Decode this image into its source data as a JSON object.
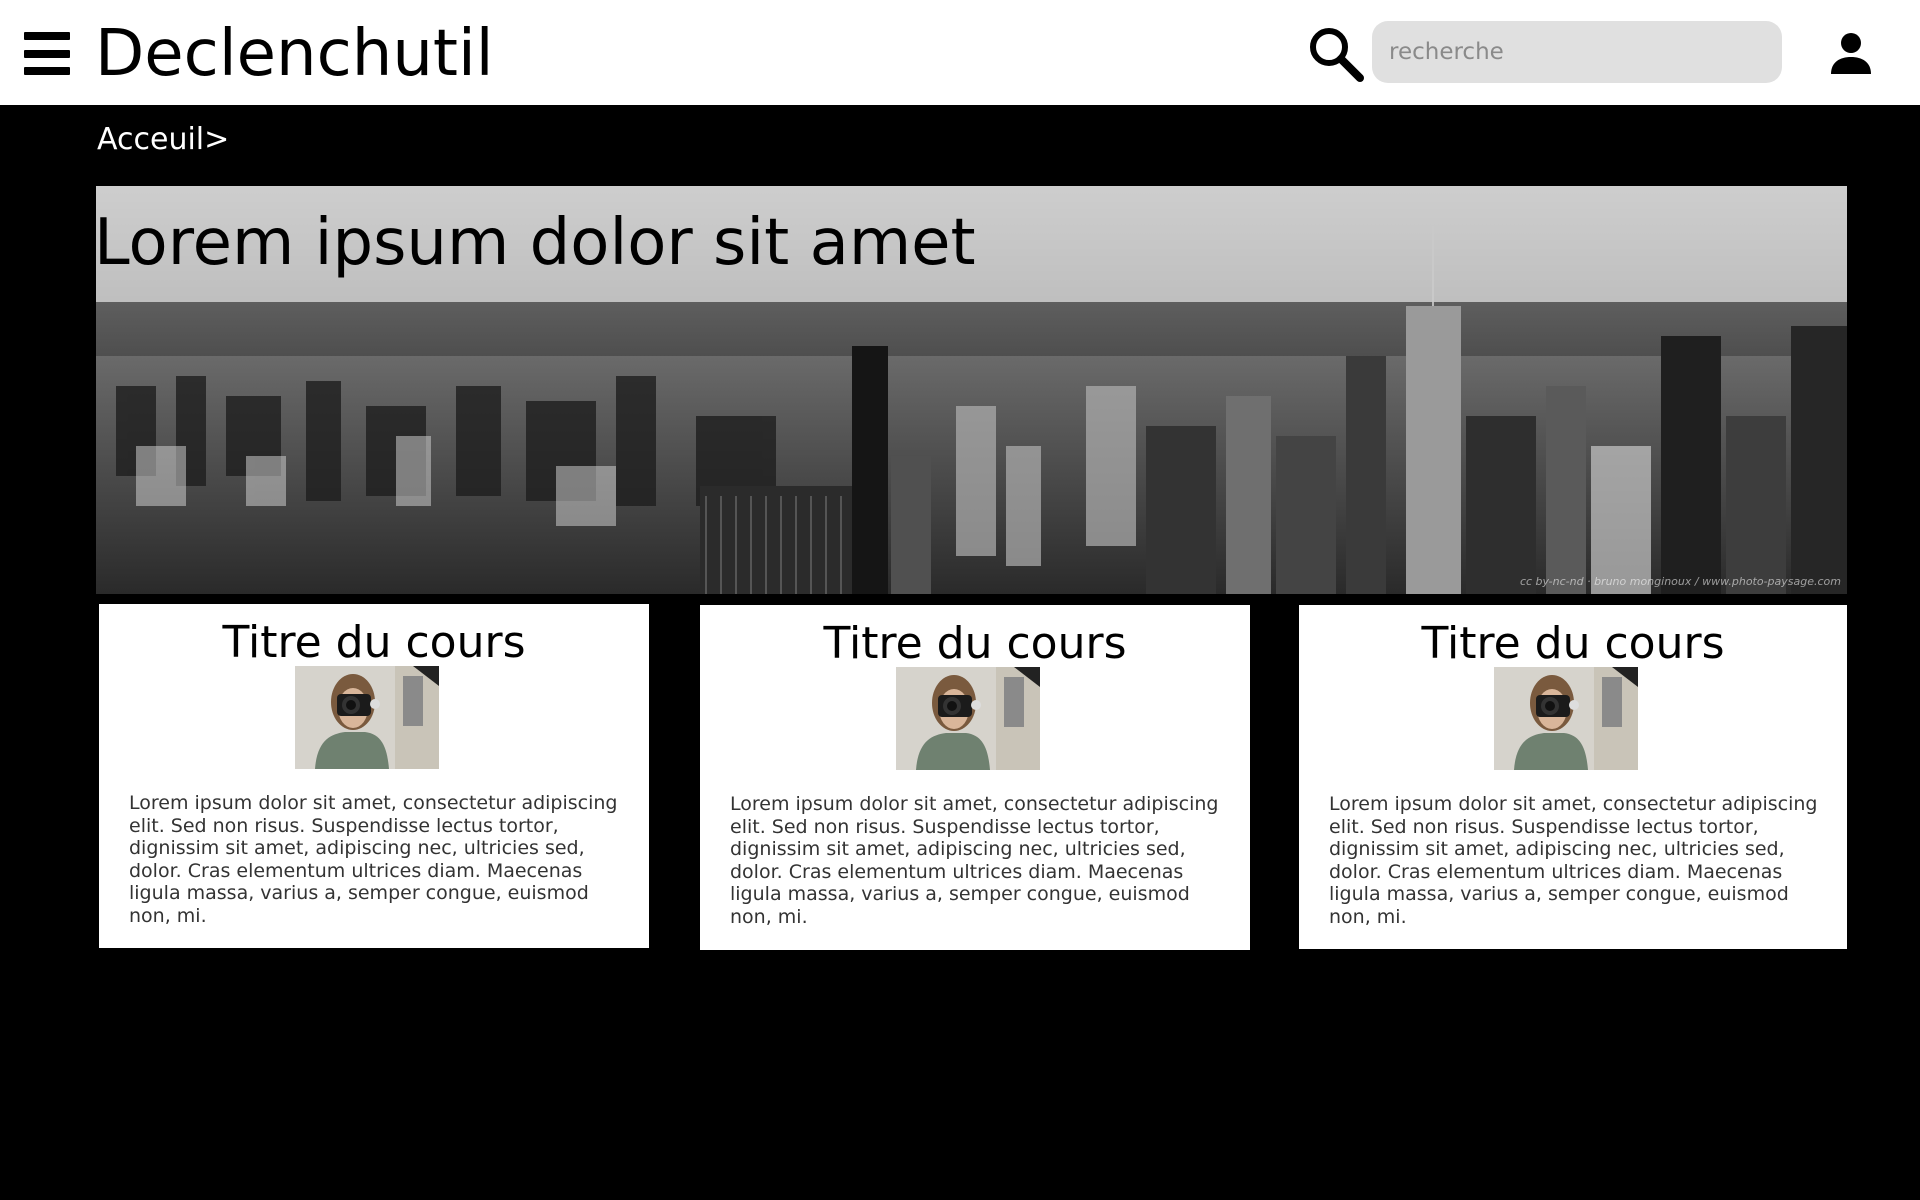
{
  "header": {
    "brand": "Declenchutil",
    "search_placeholder": "recherche",
    "icons": {
      "menu": "hamburger-menu-icon",
      "search": "search-icon",
      "user": "user-icon"
    }
  },
  "breadcrumb": {
    "text": "Acceuil>"
  },
  "hero": {
    "title": "Lorem ipsum dolor sit amet",
    "credit": "cc by-nc-nd · bruno monginoux / www.photo-paysage.com"
  },
  "cards": [
    {
      "title": "Titre du cours",
      "text": "Lorem ipsum dolor sit amet, consectetur adipiscing elit. Sed non risus. Suspendisse lectus tortor, dignissim sit amet, adipiscing nec, ultricies sed, dolor. Cras elementum ultrices diam. Maecenas ligula massa, varius a, semper congue, euismod non, mi."
    },
    {
      "title": "Titre du cours",
      "text": "Lorem ipsum dolor sit amet, consectetur adipiscing elit. Sed non risus. Suspendisse lectus tortor, dignissim sit amet, adipiscing nec, ultricies sed, dolor. Cras elementum ultrices diam. Maecenas ligula massa, varius a, semper congue, euismod non, mi."
    },
    {
      "title": "Titre du cours",
      "text": "Lorem ipsum dolor sit amet, consectetur adipiscing elit. Sed non risus. Suspendisse lectus tortor, dignissim sit amet, adipiscing nec, ultricies sed, dolor. Cras elementum ultrices diam. Maecenas ligula massa, varius a, semper congue, euismod non, mi."
    }
  ],
  "colors": {
    "page_background": "#000000",
    "header_background": "#ffffff",
    "search_background": "#e0e0e0",
    "card_background": "#ffffff"
  }
}
